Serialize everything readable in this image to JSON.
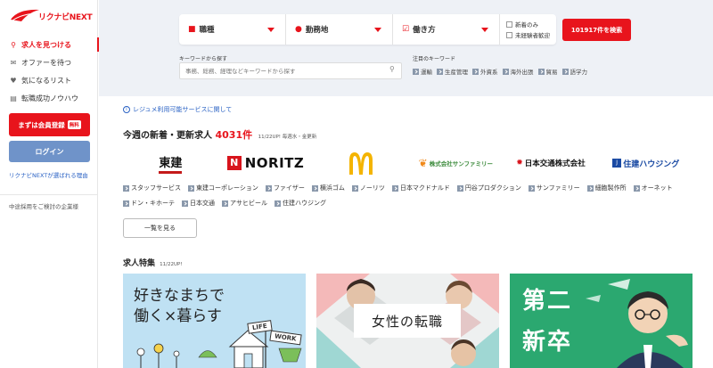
{
  "brand": {
    "logo_text": "リクナビNEXT"
  },
  "sidebar": {
    "items": [
      {
        "label": "求人を見つける",
        "icon": "search-icon"
      },
      {
        "label": "オファーを待つ",
        "icon": "mail-icon"
      },
      {
        "label": "気になるリスト",
        "icon": "heart-icon"
      },
      {
        "label": "転職成功ノウハウ",
        "icon": "book-icon"
      }
    ],
    "register_label": "まずは会員登録",
    "register_badge": "無料",
    "login_label": "ログイン",
    "why_link": "リクナビNEXTが選ばれる理由",
    "corp_link": "中途採用をご検討の企業様"
  },
  "search": {
    "job_type": "職種",
    "location": "勤務地",
    "work_style": "働き方",
    "check_new": "新着のみ",
    "check_inexp": "未経験者歓迎",
    "search_button": "101917件を検索",
    "keyword_label": "キーワードから探す",
    "keyword_placeholder": "事務、総務、経理などキーワードから探す",
    "attention_label": "注目のキーワード",
    "attention_keywords": [
      "運輸",
      "生産管理",
      "外資系",
      "海外出張",
      "貿易",
      "語学力"
    ]
  },
  "main": {
    "resume_link": "レジュメ利用可能サービスに関して",
    "section_title": "今週の新着・更新求人",
    "section_count": "4031件",
    "section_meta": "11/22UP! 毎週水・金更新",
    "company_logos": [
      "東建",
      "NORITZ",
      "McDonald's",
      "株式会社サンファミリー",
      "日本交通株式会社",
      "住建ハウジング"
    ],
    "tags": [
      "スタッフサービス",
      "東建コーポレーション",
      "ファイザー",
      "横浜ゴム",
      "ノーリツ",
      "日本マクドナルド",
      "円谷プロダクション",
      "サンファミリー",
      "細胞製作所",
      "オーネット",
      "ドン・キホーテ",
      "日本交通",
      "アサヒビール",
      "住建ハウジング"
    ],
    "more_button": "一覧を見る",
    "feature_title": "求人特集",
    "feature_date": "11/22UP!",
    "cards": [
      {
        "line1": "好きなまちで",
        "line2": "働く×暮らす",
        "sign1": "LIFE",
        "sign2": "WORK"
      },
      {
        "text": "女性の転職"
      },
      {
        "line1": "第二",
        "line2": "新卒"
      }
    ]
  },
  "colors": {
    "accent": "#e8141c",
    "login": "#6f93c9",
    "header_bg": "#eef1f6",
    "card3": "#2ba870"
  }
}
